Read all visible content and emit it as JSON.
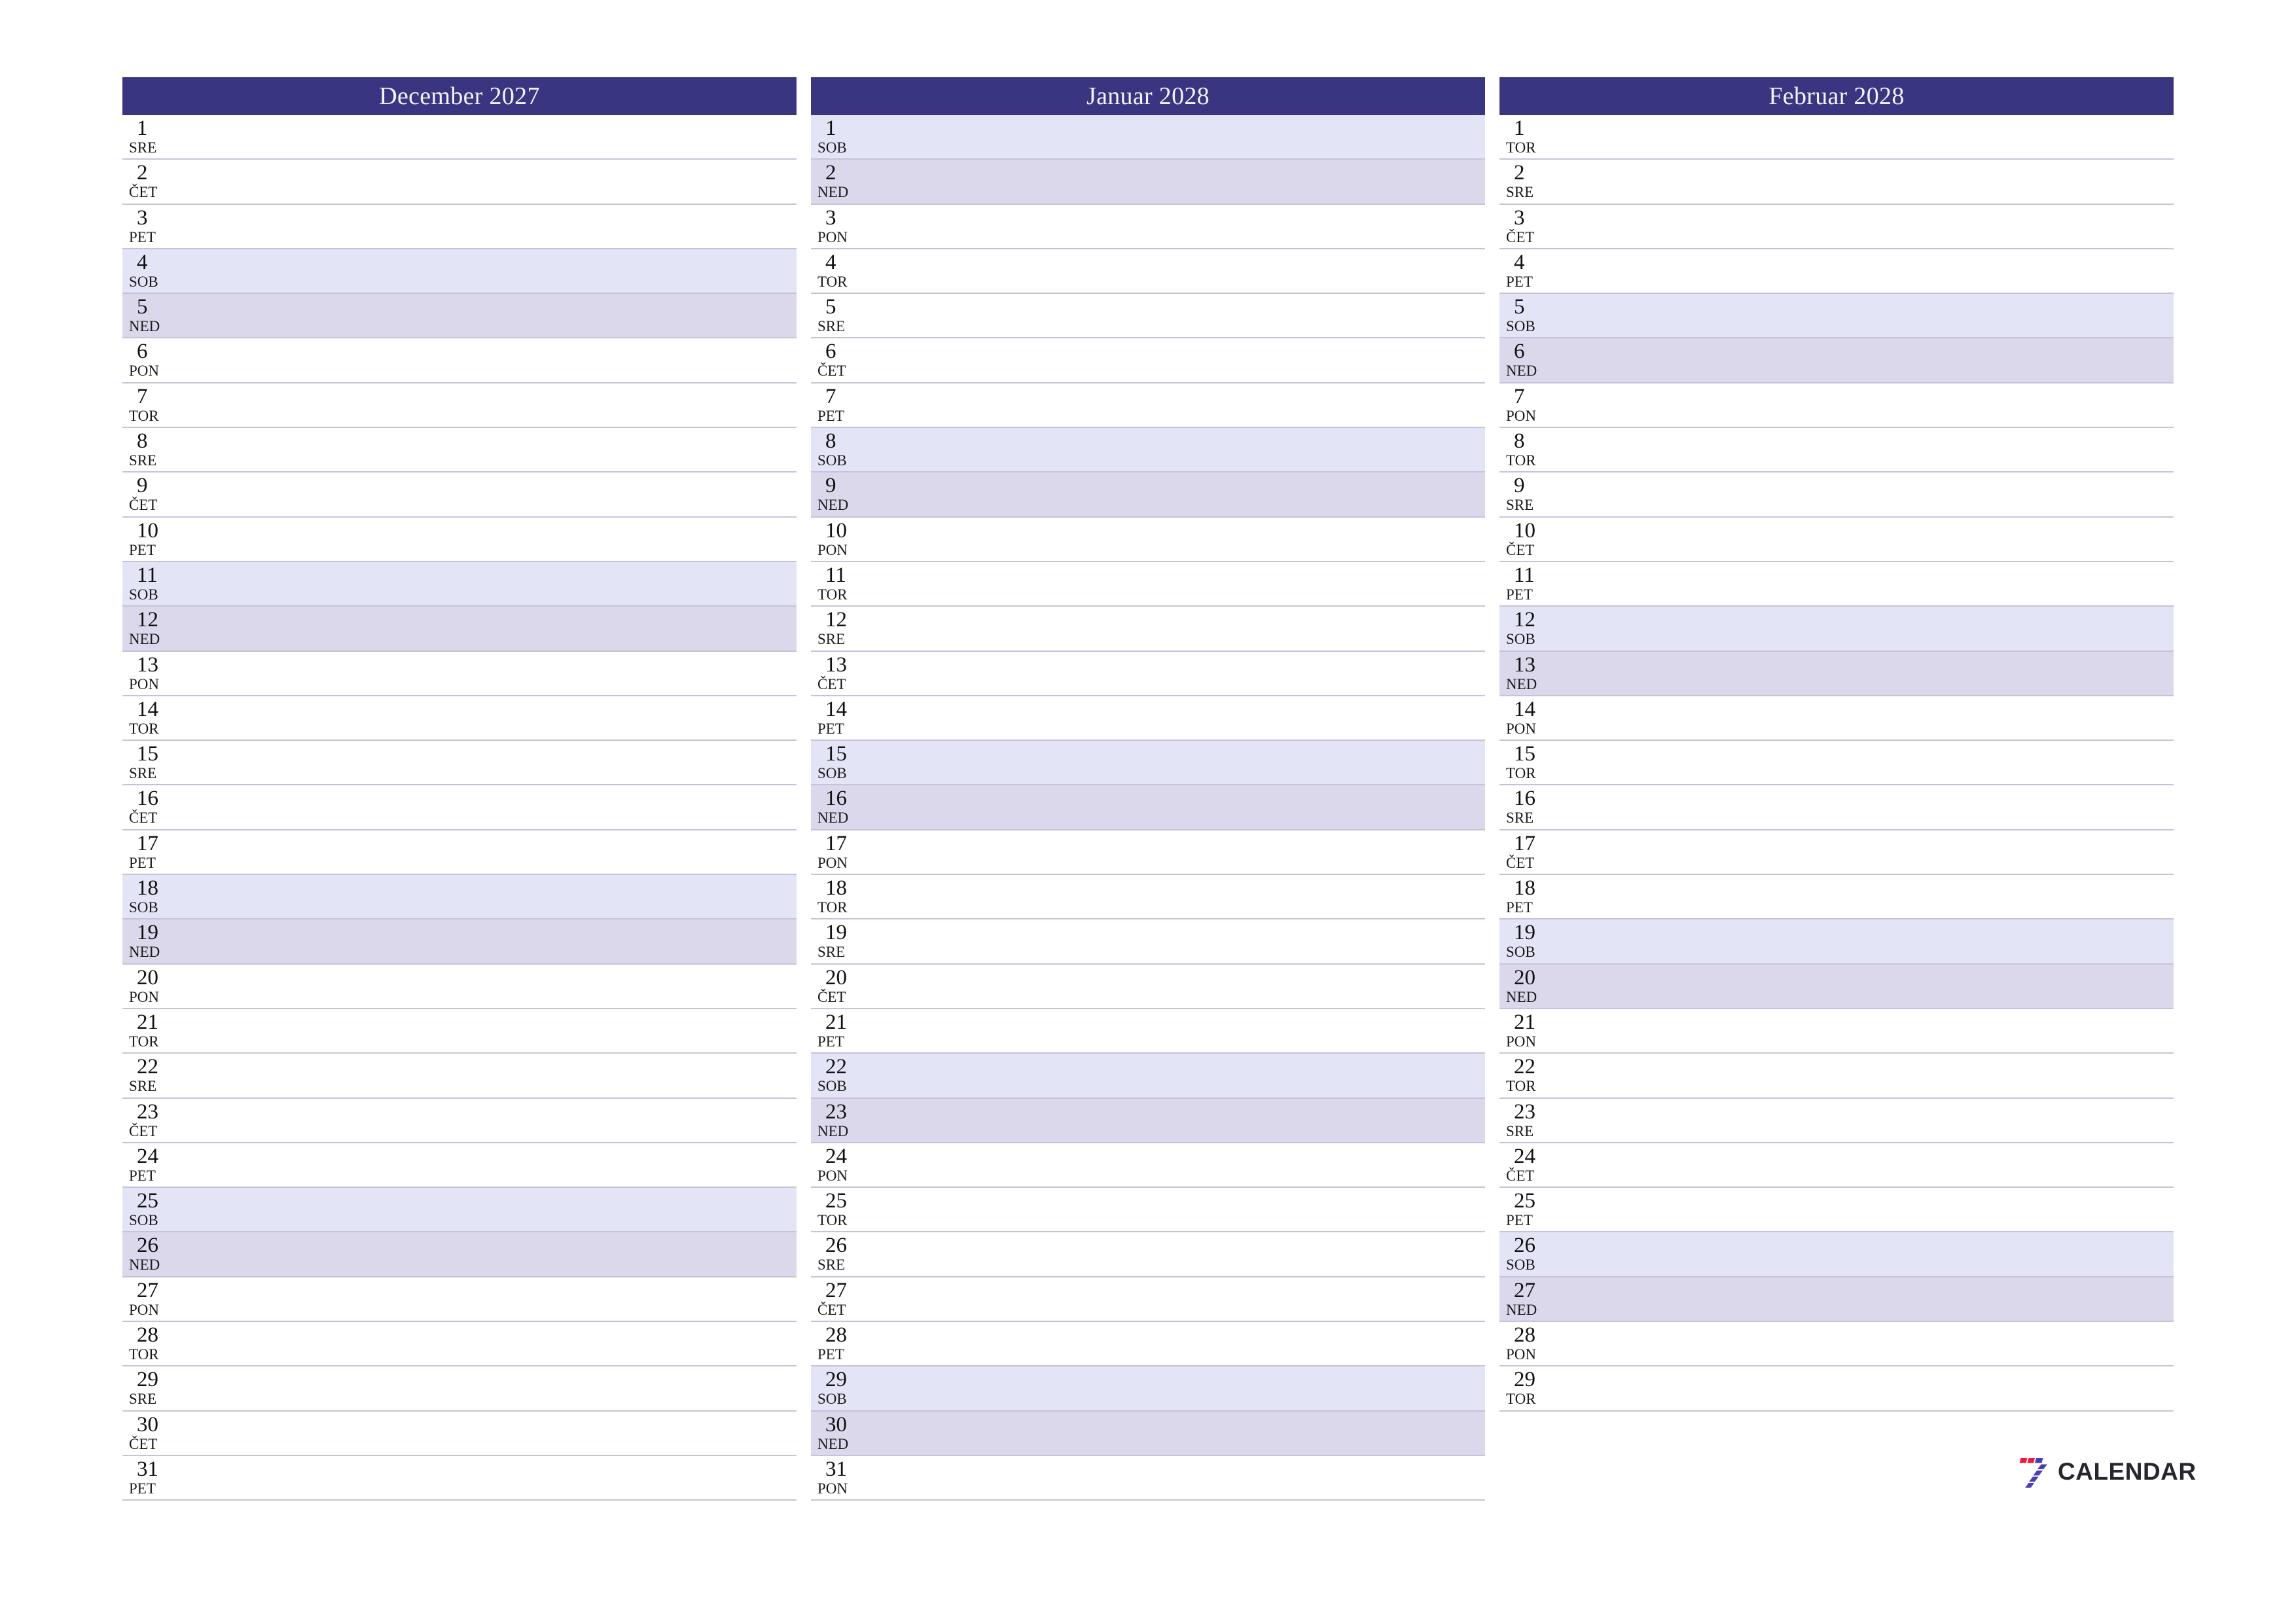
{
  "page": {
    "type": "printable-monthly-planner",
    "orientation": "landscape",
    "language": "sl",
    "background_color": "#ffffff"
  },
  "theme": {
    "header_bg": "#3a3580",
    "header_text": "#f2f1f8",
    "row_border": "#c5c3dc",
    "saturday_bg": "#e4e4f7",
    "sunday_bg": "#dcd8ec",
    "weekday_bg": "#ffffff",
    "text": "#111111",
    "logo_red": "#ee1b3c",
    "logo_purple": "#4a3fb0",
    "logo_word_color": "#26262e"
  },
  "months": [
    {
      "title": "December 2027",
      "days": [
        {
          "num": "1",
          "dow": "SRE",
          "kind": "weekday"
        },
        {
          "num": "2",
          "dow": "ČET",
          "kind": "weekday"
        },
        {
          "num": "3",
          "dow": "PET",
          "kind": "weekday"
        },
        {
          "num": "4",
          "dow": "SOB",
          "kind": "sat"
        },
        {
          "num": "5",
          "dow": "NED",
          "kind": "sun"
        },
        {
          "num": "6",
          "dow": "PON",
          "kind": "weekday"
        },
        {
          "num": "7",
          "dow": "TOR",
          "kind": "weekday"
        },
        {
          "num": "8",
          "dow": "SRE",
          "kind": "weekday"
        },
        {
          "num": "9",
          "dow": "ČET",
          "kind": "weekday"
        },
        {
          "num": "10",
          "dow": "PET",
          "kind": "weekday"
        },
        {
          "num": "11",
          "dow": "SOB",
          "kind": "sat"
        },
        {
          "num": "12",
          "dow": "NED",
          "kind": "sun"
        },
        {
          "num": "13",
          "dow": "PON",
          "kind": "weekday"
        },
        {
          "num": "14",
          "dow": "TOR",
          "kind": "weekday"
        },
        {
          "num": "15",
          "dow": "SRE",
          "kind": "weekday"
        },
        {
          "num": "16",
          "dow": "ČET",
          "kind": "weekday"
        },
        {
          "num": "17",
          "dow": "PET",
          "kind": "weekday"
        },
        {
          "num": "18",
          "dow": "SOB",
          "kind": "sat"
        },
        {
          "num": "19",
          "dow": "NED",
          "kind": "sun"
        },
        {
          "num": "20",
          "dow": "PON",
          "kind": "weekday"
        },
        {
          "num": "21",
          "dow": "TOR",
          "kind": "weekday"
        },
        {
          "num": "22",
          "dow": "SRE",
          "kind": "weekday"
        },
        {
          "num": "23",
          "dow": "ČET",
          "kind": "weekday"
        },
        {
          "num": "24",
          "dow": "PET",
          "kind": "weekday"
        },
        {
          "num": "25",
          "dow": "SOB",
          "kind": "sat"
        },
        {
          "num": "26",
          "dow": "NED",
          "kind": "sun"
        },
        {
          "num": "27",
          "dow": "PON",
          "kind": "weekday"
        },
        {
          "num": "28",
          "dow": "TOR",
          "kind": "weekday"
        },
        {
          "num": "29",
          "dow": "SRE",
          "kind": "weekday"
        },
        {
          "num": "30",
          "dow": "ČET",
          "kind": "weekday"
        },
        {
          "num": "31",
          "dow": "PET",
          "kind": "weekday"
        }
      ]
    },
    {
      "title": "Januar 2028",
      "days": [
        {
          "num": "1",
          "dow": "SOB",
          "kind": "sat"
        },
        {
          "num": "2",
          "dow": "NED",
          "kind": "sun"
        },
        {
          "num": "3",
          "dow": "PON",
          "kind": "weekday"
        },
        {
          "num": "4",
          "dow": "TOR",
          "kind": "weekday"
        },
        {
          "num": "5",
          "dow": "SRE",
          "kind": "weekday"
        },
        {
          "num": "6",
          "dow": "ČET",
          "kind": "weekday"
        },
        {
          "num": "7",
          "dow": "PET",
          "kind": "weekday"
        },
        {
          "num": "8",
          "dow": "SOB",
          "kind": "sat"
        },
        {
          "num": "9",
          "dow": "NED",
          "kind": "sun"
        },
        {
          "num": "10",
          "dow": "PON",
          "kind": "weekday"
        },
        {
          "num": "11",
          "dow": "TOR",
          "kind": "weekday"
        },
        {
          "num": "12",
          "dow": "SRE",
          "kind": "weekday"
        },
        {
          "num": "13",
          "dow": "ČET",
          "kind": "weekday"
        },
        {
          "num": "14",
          "dow": "PET",
          "kind": "weekday"
        },
        {
          "num": "15",
          "dow": "SOB",
          "kind": "sat"
        },
        {
          "num": "16",
          "dow": "NED",
          "kind": "sun"
        },
        {
          "num": "17",
          "dow": "PON",
          "kind": "weekday"
        },
        {
          "num": "18",
          "dow": "TOR",
          "kind": "weekday"
        },
        {
          "num": "19",
          "dow": "SRE",
          "kind": "weekday"
        },
        {
          "num": "20",
          "dow": "ČET",
          "kind": "weekday"
        },
        {
          "num": "21",
          "dow": "PET",
          "kind": "weekday"
        },
        {
          "num": "22",
          "dow": "SOB",
          "kind": "sat"
        },
        {
          "num": "23",
          "dow": "NED",
          "kind": "sun"
        },
        {
          "num": "24",
          "dow": "PON",
          "kind": "weekday"
        },
        {
          "num": "25",
          "dow": "TOR",
          "kind": "weekday"
        },
        {
          "num": "26",
          "dow": "SRE",
          "kind": "weekday"
        },
        {
          "num": "27",
          "dow": "ČET",
          "kind": "weekday"
        },
        {
          "num": "28",
          "dow": "PET",
          "kind": "weekday"
        },
        {
          "num": "29",
          "dow": "SOB",
          "kind": "sat"
        },
        {
          "num": "30",
          "dow": "NED",
          "kind": "sun"
        },
        {
          "num": "31",
          "dow": "PON",
          "kind": "weekday"
        }
      ]
    },
    {
      "title": "Februar 2028",
      "days": [
        {
          "num": "1",
          "dow": "TOR",
          "kind": "weekday"
        },
        {
          "num": "2",
          "dow": "SRE",
          "kind": "weekday"
        },
        {
          "num": "3",
          "dow": "ČET",
          "kind": "weekday"
        },
        {
          "num": "4",
          "dow": "PET",
          "kind": "weekday"
        },
        {
          "num": "5",
          "dow": "SOB",
          "kind": "sat"
        },
        {
          "num": "6",
          "dow": "NED",
          "kind": "sun"
        },
        {
          "num": "7",
          "dow": "PON",
          "kind": "weekday"
        },
        {
          "num": "8",
          "dow": "TOR",
          "kind": "weekday"
        },
        {
          "num": "9",
          "dow": "SRE",
          "kind": "weekday"
        },
        {
          "num": "10",
          "dow": "ČET",
          "kind": "weekday"
        },
        {
          "num": "11",
          "dow": "PET",
          "kind": "weekday"
        },
        {
          "num": "12",
          "dow": "SOB",
          "kind": "sat"
        },
        {
          "num": "13",
          "dow": "NED",
          "kind": "sun"
        },
        {
          "num": "14",
          "dow": "PON",
          "kind": "weekday"
        },
        {
          "num": "15",
          "dow": "TOR",
          "kind": "weekday"
        },
        {
          "num": "16",
          "dow": "SRE",
          "kind": "weekday"
        },
        {
          "num": "17",
          "dow": "ČET",
          "kind": "weekday"
        },
        {
          "num": "18",
          "dow": "PET",
          "kind": "weekday"
        },
        {
          "num": "19",
          "dow": "SOB",
          "kind": "sat"
        },
        {
          "num": "20",
          "dow": "NED",
          "kind": "sun"
        },
        {
          "num": "21",
          "dow": "PON",
          "kind": "weekday"
        },
        {
          "num": "22",
          "dow": "TOR",
          "kind": "weekday"
        },
        {
          "num": "23",
          "dow": "SRE",
          "kind": "weekday"
        },
        {
          "num": "24",
          "dow": "ČET",
          "kind": "weekday"
        },
        {
          "num": "25",
          "dow": "PET",
          "kind": "weekday"
        },
        {
          "num": "26",
          "dow": "SOB",
          "kind": "sat"
        },
        {
          "num": "27",
          "dow": "NED",
          "kind": "sun"
        },
        {
          "num": "28",
          "dow": "PON",
          "kind": "weekday"
        },
        {
          "num": "29",
          "dow": "TOR",
          "kind": "weekday"
        }
      ]
    }
  ],
  "logo": {
    "icon_name": "seven-calendar-logo",
    "wordmark": "CALENDAR"
  }
}
